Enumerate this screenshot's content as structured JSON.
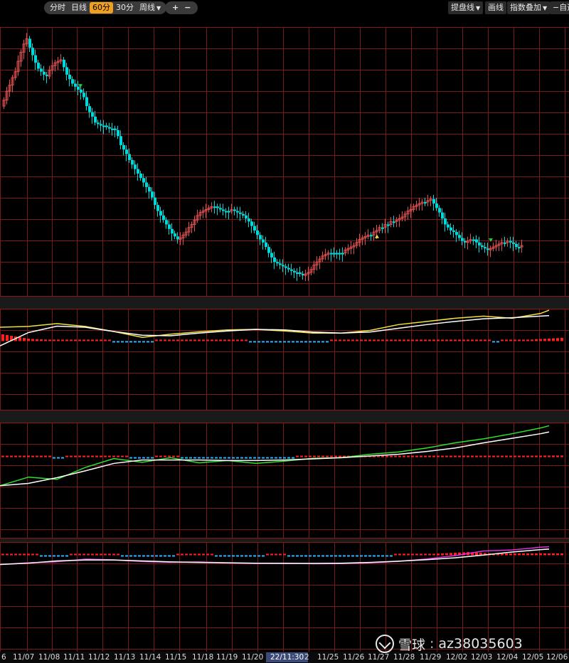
{
  "toolbar": {
    "periods": [
      {
        "label": "分时",
        "active": false
      },
      {
        "label": "日线",
        "active": false
      },
      {
        "label": "60分",
        "active": true
      },
      {
        "label": "30分",
        "active": false
      },
      {
        "label": "周线",
        "active": false,
        "dropdown": true
      }
    ],
    "zoom_in": "+",
    "zoom_out": "−",
    "right": [
      {
        "label": "提盘线",
        "dropdown": true
      },
      {
        "label": "画线",
        "dropdown": false
      },
      {
        "label": "指数叠加",
        "dropdown": true
      },
      {
        "label": "−自选",
        "dropdown": false
      }
    ]
  },
  "x_axis": {
    "labels": [
      "6",
      "11/07",
      "11/08",
      "11/11",
      "11/12",
      "11/13",
      "11/14",
      "11/15",
      "11/18",
      "11/19",
      "11/20",
      "22/11:30",
      "2",
      "11/25",
      "11/26",
      "11/27",
      "11/28",
      "11/29",
      "12/02",
      "12/03",
      "12/04",
      "12/05",
      "12/06"
    ],
    "highlighted": "22/11:30"
  },
  "watermark": {
    "brand": "雪球",
    "user": "az38035603"
  },
  "colors": {
    "up": "#e05050",
    "down": "#00d8d8",
    "grid": "#7a1a1a",
    "ma_yellow": "#f0e040",
    "ma_white": "#ffffff",
    "ma_green": "#30e030",
    "ma_magenta": "#e030e0",
    "hist_up": "#ff2020",
    "hist_down": "#30b0ff",
    "signal_green": "#20d040",
    "signal_yellow": "#f0e040"
  },
  "chart_data": [
    {
      "type": "candlestick",
      "x": [
        0,
        4,
        8,
        12,
        16,
        20,
        24,
        28,
        32,
        36,
        40,
        44,
        48,
        52,
        56,
        60,
        64,
        68,
        72,
        76,
        80,
        84,
        88,
        92,
        96,
        100,
        104,
        108,
        112,
        116,
        120,
        124,
        128,
        132,
        136,
        140,
        144,
        148,
        152,
        156,
        160,
        164,
        168,
        172,
        176,
        180,
        184,
        188,
        192,
        196,
        200,
        204,
        208,
        212,
        216,
        220,
        224,
        228,
        232,
        236,
        240,
        244,
        248,
        252,
        256,
        260,
        264,
        268,
        272,
        276,
        280,
        284,
        288,
        292,
        296,
        300,
        304,
        308,
        312,
        316,
        320,
        324,
        328,
        332,
        336,
        340,
        344,
        348,
        352,
        356,
        360,
        364,
        368,
        372,
        376,
        380,
        384,
        388,
        392,
        396,
        400,
        404,
        408,
        412,
        416,
        420,
        424,
        428,
        432,
        436,
        440,
        444,
        448,
        452,
        456,
        460,
        464,
        468,
        472,
        476,
        480,
        484,
        488,
        492,
        496,
        500,
        504,
        508,
        512,
        516,
        520,
        524,
        528,
        532,
        536,
        540,
        544,
        548,
        552,
        556,
        560,
        564,
        568,
        572,
        576,
        580,
        584,
        588,
        592,
        596,
        600,
        604,
        608,
        612,
        616,
        620,
        624,
        628,
        632,
        636,
        640,
        644,
        648,
        652,
        656,
        660,
        664,
        668,
        672,
        676,
        680,
        684,
        688,
        692,
        696,
        700,
        704,
        708,
        712,
        716,
        720,
        724,
        728,
        732,
        736,
        740,
        744,
        748,
        752,
        756,
        760,
        764,
        768,
        772
      ],
      "open": [
        138,
        130,
        118,
        110,
        100,
        92,
        78,
        66,
        55,
        48,
        60,
        70,
        80,
        88,
        92,
        96,
        98,
        90,
        84,
        80,
        78,
        76,
        86,
        96,
        102,
        108,
        112,
        116,
        120,
        126,
        138,
        146,
        152,
        160,
        162,
        164,
        164,
        166,
        168,
        168,
        170,
        178,
        190,
        196,
        202,
        210,
        216,
        222,
        228,
        234,
        240,
        246,
        252,
        260,
        270,
        278,
        284,
        290,
        296,
        302,
        308,
        312,
        316,
        314,
        310,
        306,
        300,
        296,
        290,
        284,
        280,
        278,
        276,
        274,
        272,
        272,
        274,
        276,
        278,
        278,
        278,
        276,
        278,
        280,
        282,
        284,
        288,
        292,
        298,
        304,
        310,
        316,
        320,
        326,
        334,
        340,
        346,
        348,
        350,
        352,
        354,
        356,
        358,
        360,
        360,
        362,
        364,
        362,
        360,
        356,
        350,
        346,
        342,
        338,
        336,
        334,
        334,
        334,
        334,
        334,
        334,
        330,
        328,
        326,
        324,
        320,
        316,
        314,
        312,
        310,
        310,
        306,
        304,
        300,
        300,
        296,
        296,
        292,
        292,
        290,
        288,
        286,
        282,
        278,
        276,
        272,
        270,
        268,
        266,
        266,
        264,
        262,
        268,
        274,
        280,
        288,
        296,
        300,
        304,
        306,
        310,
        314,
        318,
        320,
        318,
        316,
        316,
        320,
        324,
        326,
        328,
        330,
        328,
        326,
        324,
        322,
        320,
        320,
        318,
        320,
        322,
        326,
        326
      ],
      "close": [
        130,
        118,
        110,
        100,
        92,
        78,
        66,
        55,
        48,
        60,
        70,
        80,
        88,
        92,
        96,
        98,
        90,
        84,
        80,
        78,
        76,
        86,
        96,
        102,
        108,
        112,
        116,
        120,
        126,
        138,
        146,
        152,
        160,
        162,
        164,
        164,
        166,
        168,
        168,
        170,
        178,
        190,
        196,
        202,
        210,
        216,
        222,
        228,
        234,
        240,
        246,
        252,
        260,
        270,
        278,
        284,
        290,
        296,
        302,
        308,
        312,
        316,
        314,
        310,
        306,
        300,
        296,
        290,
        284,
        280,
        278,
        276,
        274,
        272,
        272,
        274,
        276,
        278,
        278,
        278,
        276,
        278,
        280,
        282,
        284,
        288,
        292,
        298,
        304,
        310,
        316,
        320,
        326,
        334,
        340,
        346,
        348,
        350,
        352,
        354,
        356,
        358,
        360,
        360,
        362,
        364,
        362,
        360,
        356,
        350,
        346,
        342,
        338,
        336,
        334,
        334,
        334,
        334,
        334,
        334,
        330,
        328,
        326,
        324,
        320,
        316,
        314,
        312,
        310,
        310,
        306,
        304,
        300,
        300,
        296,
        296,
        292,
        292,
        290,
        288,
        286,
        282,
        278,
        276,
        272,
        270,
        268,
        266,
        266,
        264,
        262,
        268,
        274,
        280,
        288,
        296,
        300,
        304,
        306,
        310,
        314,
        318,
        320,
        318,
        316,
        316,
        320,
        324,
        326,
        328,
        330,
        328,
        326,
        324,
        322,
        320,
        320,
        318,
        320,
        322,
        326,
        326,
        324
      ],
      "signals": [
        {
          "x": 113,
          "kind": "sell",
          "color": "green"
        },
        {
          "x": 530,
          "kind": "buy",
          "color": "yellow"
        },
        {
          "x": 690,
          "kind": "sell",
          "color": "green"
        }
      ]
    },
    {
      "type": "line",
      "panel": "indicator-1",
      "series": [
        {
          "color": "yellow",
          "x": [
            0,
            40,
            80,
            120,
            160,
            200,
            240,
            280,
            320,
            360,
            400,
            440,
            480,
            520,
            560,
            600,
            640,
            680,
            720,
            760,
            772
          ],
          "values": [
            0.52,
            0.55,
            0.66,
            0.55,
            0.36,
            0.14,
            0.26,
            0.35,
            0.42,
            0.44,
            0.38,
            0.3,
            0.3,
            0.4,
            0.62,
            0.74,
            0.86,
            0.94,
            0.86,
            1.04,
            1.22
          ]
        },
        {
          "color": "white",
          "x": [
            0,
            40,
            80,
            120,
            160,
            200,
            240,
            280,
            320,
            360,
            400,
            440,
            480,
            520,
            560,
            600,
            640,
            680,
            720,
            760,
            772
          ],
          "values": [
            -0.18,
            0.32,
            0.56,
            0.52,
            0.36,
            0.22,
            0.2,
            0.3,
            0.38,
            0.44,
            0.42,
            0.34,
            0.3,
            0.34,
            0.48,
            0.62,
            0.74,
            0.84,
            0.88,
            0.94,
            0.96
          ]
        }
      ]
    },
    {
      "type": "line",
      "panel": "indicator-2",
      "series": [
        {
          "color": "green",
          "x": [
            0,
            40,
            80,
            120,
            160,
            200,
            240,
            280,
            320,
            360,
            400,
            440,
            480,
            520,
            560,
            600,
            640,
            680,
            720,
            760,
            772
          ],
          "values": [
            -1.0,
            -0.7,
            -0.78,
            -0.36,
            -0.05,
            -0.18,
            -0.02,
            -0.2,
            -0.12,
            -0.22,
            -0.14,
            -0.04,
            -0.02,
            0.1,
            0.18,
            0.32,
            0.5,
            0.64,
            0.82,
            1.02,
            1.1
          ]
        },
        {
          "color": "white",
          "x": [
            0,
            40,
            80,
            120,
            160,
            200,
            240,
            280,
            320,
            360,
            400,
            440,
            480,
            520,
            560,
            600,
            640,
            680,
            720,
            760,
            772
          ],
          "values": [
            -1.0,
            -0.92,
            -0.72,
            -0.48,
            -0.22,
            -0.1,
            -0.1,
            -0.1,
            -0.12,
            -0.12,
            -0.1,
            -0.06,
            -0.02,
            0.04,
            0.1,
            0.2,
            0.32,
            0.5,
            0.66,
            0.82,
            0.88
          ]
        }
      ]
    },
    {
      "type": "line",
      "panel": "indicator-3",
      "series": [
        {
          "color": "magenta",
          "x": [
            0,
            40,
            80,
            120,
            160,
            200,
            240,
            280,
            320,
            360,
            400,
            440,
            480,
            520,
            560,
            600,
            640,
            680,
            720,
            760,
            772
          ],
          "values": [
            -1.0,
            -0.82,
            -0.7,
            -0.42,
            -0.5,
            -0.68,
            -0.76,
            -0.72,
            -0.84,
            -0.9,
            -0.86,
            -0.92,
            -0.9,
            -0.82,
            -0.66,
            -0.4,
            -0.04,
            0.46,
            0.56,
            0.86,
            0.92
          ]
        },
        {
          "color": "white",
          "x": [
            0,
            40,
            80,
            120,
            160,
            200,
            240,
            280,
            320,
            360,
            400,
            440,
            480,
            520,
            560,
            600,
            640,
            680,
            720,
            760,
            772
          ],
          "values": [
            -1.0,
            -0.86,
            -0.62,
            -0.52,
            -0.52,
            -0.62,
            -0.72,
            -0.78,
            -0.82,
            -0.86,
            -0.88,
            -0.88,
            -0.86,
            -0.78,
            -0.64,
            -0.48,
            -0.28,
            0.02,
            0.34,
            0.6,
            0.66
          ]
        }
      ]
    }
  ]
}
